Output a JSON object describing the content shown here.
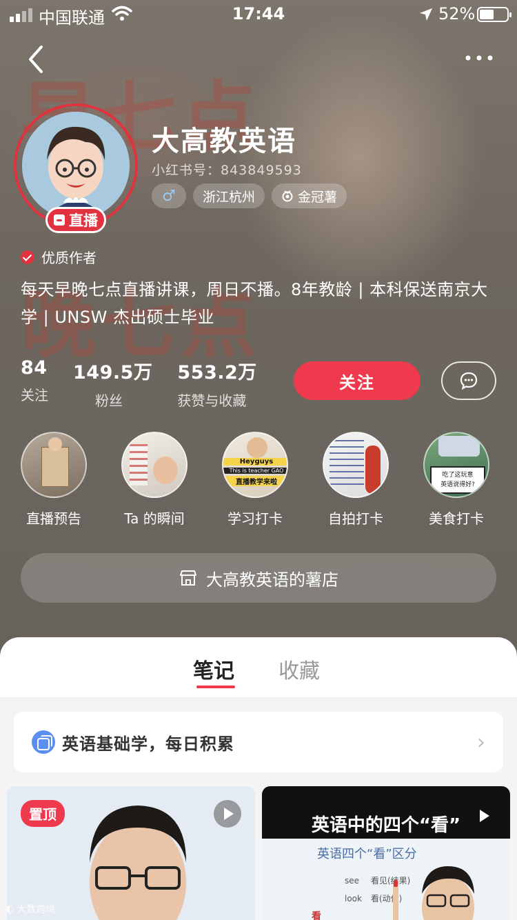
{
  "status_bar": {
    "carrier": "中国联通",
    "time": "17:44",
    "battery_percent": "52%"
  },
  "profile": {
    "name": "大高教英语",
    "red_id": "小红书号：843849593",
    "live_badge": "直播",
    "tags": [
      "浙江杭州",
      "金冠薯"
    ],
    "quality_label": "优质作者",
    "bio": "每天早晚七点直播讲课，周日不播。8年教龄 | 本科保送南京大学 | UNSW 杰出硕士毕业",
    "stats": [
      {
        "value": "84",
        "label": "关注"
      },
      {
        "value": "149.5万",
        "label": "粉丝"
      },
      {
        "value": "553.2万",
        "label": "获赞与收藏"
      }
    ],
    "follow_label": "关注"
  },
  "highlights": [
    {
      "label": "直播预告"
    },
    {
      "label": "Ta 的瞬间"
    },
    {
      "label": "学习打卡"
    },
    {
      "label": "自拍打卡"
    },
    {
      "label": "美食打卡"
    }
  ],
  "highlight_thumb_text": {
    "study": [
      "Heyguys",
      "This is teacher GAO",
      "直播教学来啦"
    ],
    "food": [
      "吃了这玩意",
      "英语说得好?"
    ]
  },
  "shop_label": "大高教英语的薯店",
  "tabs": {
    "notes": "笔记",
    "favorites": "收藏"
  },
  "collection": {
    "title": "英语基础学，每日积累"
  },
  "cards": {
    "pinned_label": "置顶",
    "right_title": "英语中的四个“看”",
    "right_subtitle": "英语四个“看”区分",
    "right_words": [
      "see",
      "look"
    ],
    "right_meanings": [
      "看见(结果)",
      "看(动作)"
    ],
    "right_kan": "看"
  },
  "watermark": "大数跨境",
  "colors": {
    "accent": "#ee3a4c",
    "background": "#6f6a63"
  }
}
